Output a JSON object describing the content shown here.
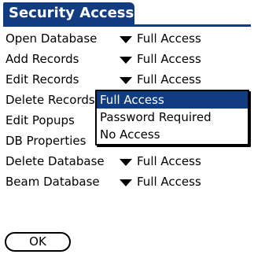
{
  "title": "Security Access",
  "colors": {
    "title_background": "#123c82",
    "popup_selected_background": "#123c82",
    "foreground": "#000000",
    "background": "#ffffff"
  },
  "rows": [
    {
      "label": "Open Database",
      "value": "Full Access"
    },
    {
      "label": "Add Records",
      "value": "Full Access"
    },
    {
      "label": "Edit Records",
      "value": "Full Access"
    },
    {
      "label": "Delete Records",
      "value": ""
    },
    {
      "label": "Edit Popups",
      "value": ""
    },
    {
      "label": "DB Properties",
      "value": ""
    },
    {
      "label": "Delete Database",
      "value": "Full Access"
    },
    {
      "label": "Beam Database",
      "value": "Full Access"
    }
  ],
  "popup": {
    "options": [
      "Full Access",
      "Password Required",
      "No Access"
    ],
    "selected": "Full Access"
  },
  "buttons": {
    "ok": "OK"
  },
  "icons": {
    "dropdown": "triangle-down-icon"
  }
}
